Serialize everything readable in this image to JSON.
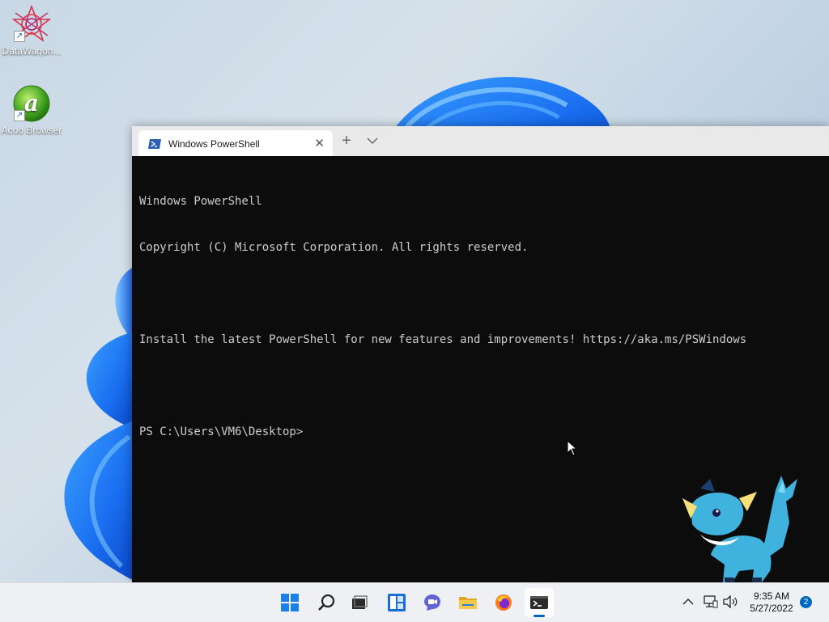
{
  "desktop": {
    "icons": [
      {
        "label": "DataWagon...",
        "icon": "datawagon-icon"
      },
      {
        "label": "Acoo Browser",
        "icon": "acoo-browser-icon"
      }
    ]
  },
  "terminal": {
    "tab_title": "Windows PowerShell",
    "lines": [
      "Windows PowerShell",
      "Copyright (C) Microsoft Corporation. All rights reserved.",
      "",
      "Install the latest PowerShell for new features and improvements! https://aka.ms/PSWindows",
      "",
      "PS C:\\Users\\VM6\\Desktop>"
    ],
    "background_color": "#0c0c0c",
    "text_color": "#cccccc"
  },
  "taskbar": {
    "apps": [
      "start-icon",
      "search-icon",
      "task-view-icon",
      "widgets-icon",
      "teams-chat-icon",
      "file-explorer-icon",
      "firefox-icon",
      "terminal-icon"
    ],
    "active_app": "terminal-icon",
    "tray_icons": [
      "chevron-up-icon",
      "network-icon",
      "volume-icon"
    ],
    "time": "9:35 AM",
    "date": "5/27/2022",
    "notification_count": "2",
    "accent_color": "#0067c0"
  }
}
